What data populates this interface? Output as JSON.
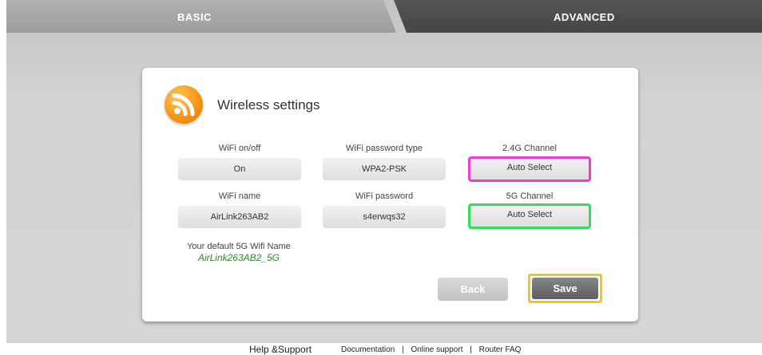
{
  "tabs": {
    "basic": "BASIC",
    "advanced": "ADVANCED"
  },
  "panel": {
    "title": "Wireless settings",
    "icon": "wifi-signal-icon",
    "fields": {
      "wifi_onoff": {
        "label": "WiFi on/off",
        "value": "On"
      },
      "password_type": {
        "label": "WiFi password type",
        "value": "WPA2-PSK"
      },
      "channel_24g": {
        "label": "2.4G Channel",
        "value": "Auto Select"
      },
      "wifi_name": {
        "label": "WiFi name",
        "value": "AirLink263AB2"
      },
      "wifi_password": {
        "label": "WiFi password",
        "value": "s4erwqs32"
      },
      "channel_5g": {
        "label": "5G Channel",
        "value": "Auto Select"
      }
    },
    "default_5g": {
      "label": "Your default 5G Wifi Name",
      "value": "AirLink263AB2_5G"
    },
    "buttons": {
      "back": "Back",
      "save": "Save"
    }
  },
  "footer": {
    "help": "Help &Support",
    "links": [
      "Documentation",
      "Online support",
      "Router FAQ"
    ],
    "separator": "|"
  },
  "colors": {
    "highlight_24g_channel": "#ee3ed2",
    "highlight_5g_channel": "#36dc57",
    "highlight_save": "#f5c51f",
    "default_5g_name": "#2c8a2c",
    "icon_orange": "#f79a1c"
  }
}
